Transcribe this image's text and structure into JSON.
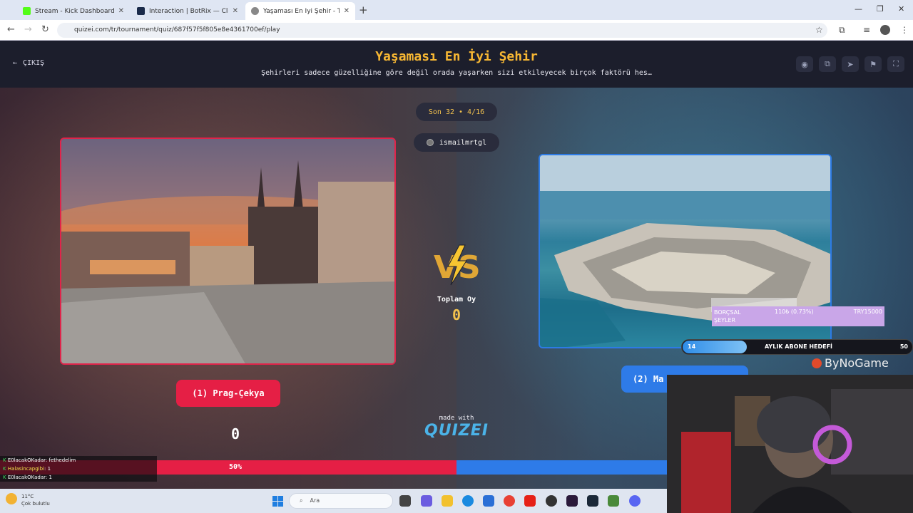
{
  "browser": {
    "tabs": [
      {
        "title": "Stream - Kick Dashboard",
        "favicon_color": "#53fc18",
        "active": false
      },
      {
        "title": "Interaction | BotRix — Cloud St...",
        "favicon_color": "#1a2b4a",
        "active": false
      },
      {
        "title": "Yaşaması En İyi Şehir - Tier List",
        "favicon_color": "#888888",
        "active": true
      }
    ],
    "new_tab_icon": "+",
    "url": "quizei.com/tr/tournament/quiz/687f57f5f805e8e4361700ef/play"
  },
  "header": {
    "exit_label": "ÇIKIŞ",
    "title": "Yaşaması En İyi Şehir",
    "subtitle": "Şehirleri sadece güzelliğine göre değil orada yaşarken sizi etkileyecek birçok faktörü hes…",
    "icons": [
      "eye-icon",
      "copy-icon",
      "send-icon",
      "flag-icon",
      "fullscreen-icon"
    ]
  },
  "round": {
    "label": "Son 32 • 4/16",
    "username": "ismailmrtgl"
  },
  "left_option": {
    "label": "(1) Prag-Çekya",
    "votes": "0",
    "percent": "50%"
  },
  "right_option": {
    "label": "(2) Ma"
  },
  "center": {
    "vs_label": "VS",
    "total_label": "Toplam Oy",
    "total_value": "0",
    "made_with": "made with",
    "brand": "QUIZEI"
  },
  "stream_overlay": {
    "chat": [
      {
        "user": "E0lacakOKadar",
        "msg": ": fethedelim"
      },
      {
        "user": "Halasincapgibi",
        "msg": ": 1"
      },
      {
        "user": "E0lacakOKadar",
        "msg": ": 1"
      }
    ],
    "borc": {
      "label": "BORÇSAL ŞEYLER",
      "value": "110₺ (0.73%)",
      "target": "TRY15000"
    },
    "sub_goal": {
      "current": "14",
      "label": "AYLIK ABONE HEDEFİ",
      "max": "50",
      "progress": 0.28
    },
    "brand": "ByNoGame"
  },
  "taskbar": {
    "temp": "11°C",
    "weather": "Çok bulutlu",
    "search_placeholder": "Ara"
  },
  "colors": {
    "accent_red": "#e51f45",
    "accent_blue": "#2e7be8",
    "title_gold": "#f7b733"
  }
}
